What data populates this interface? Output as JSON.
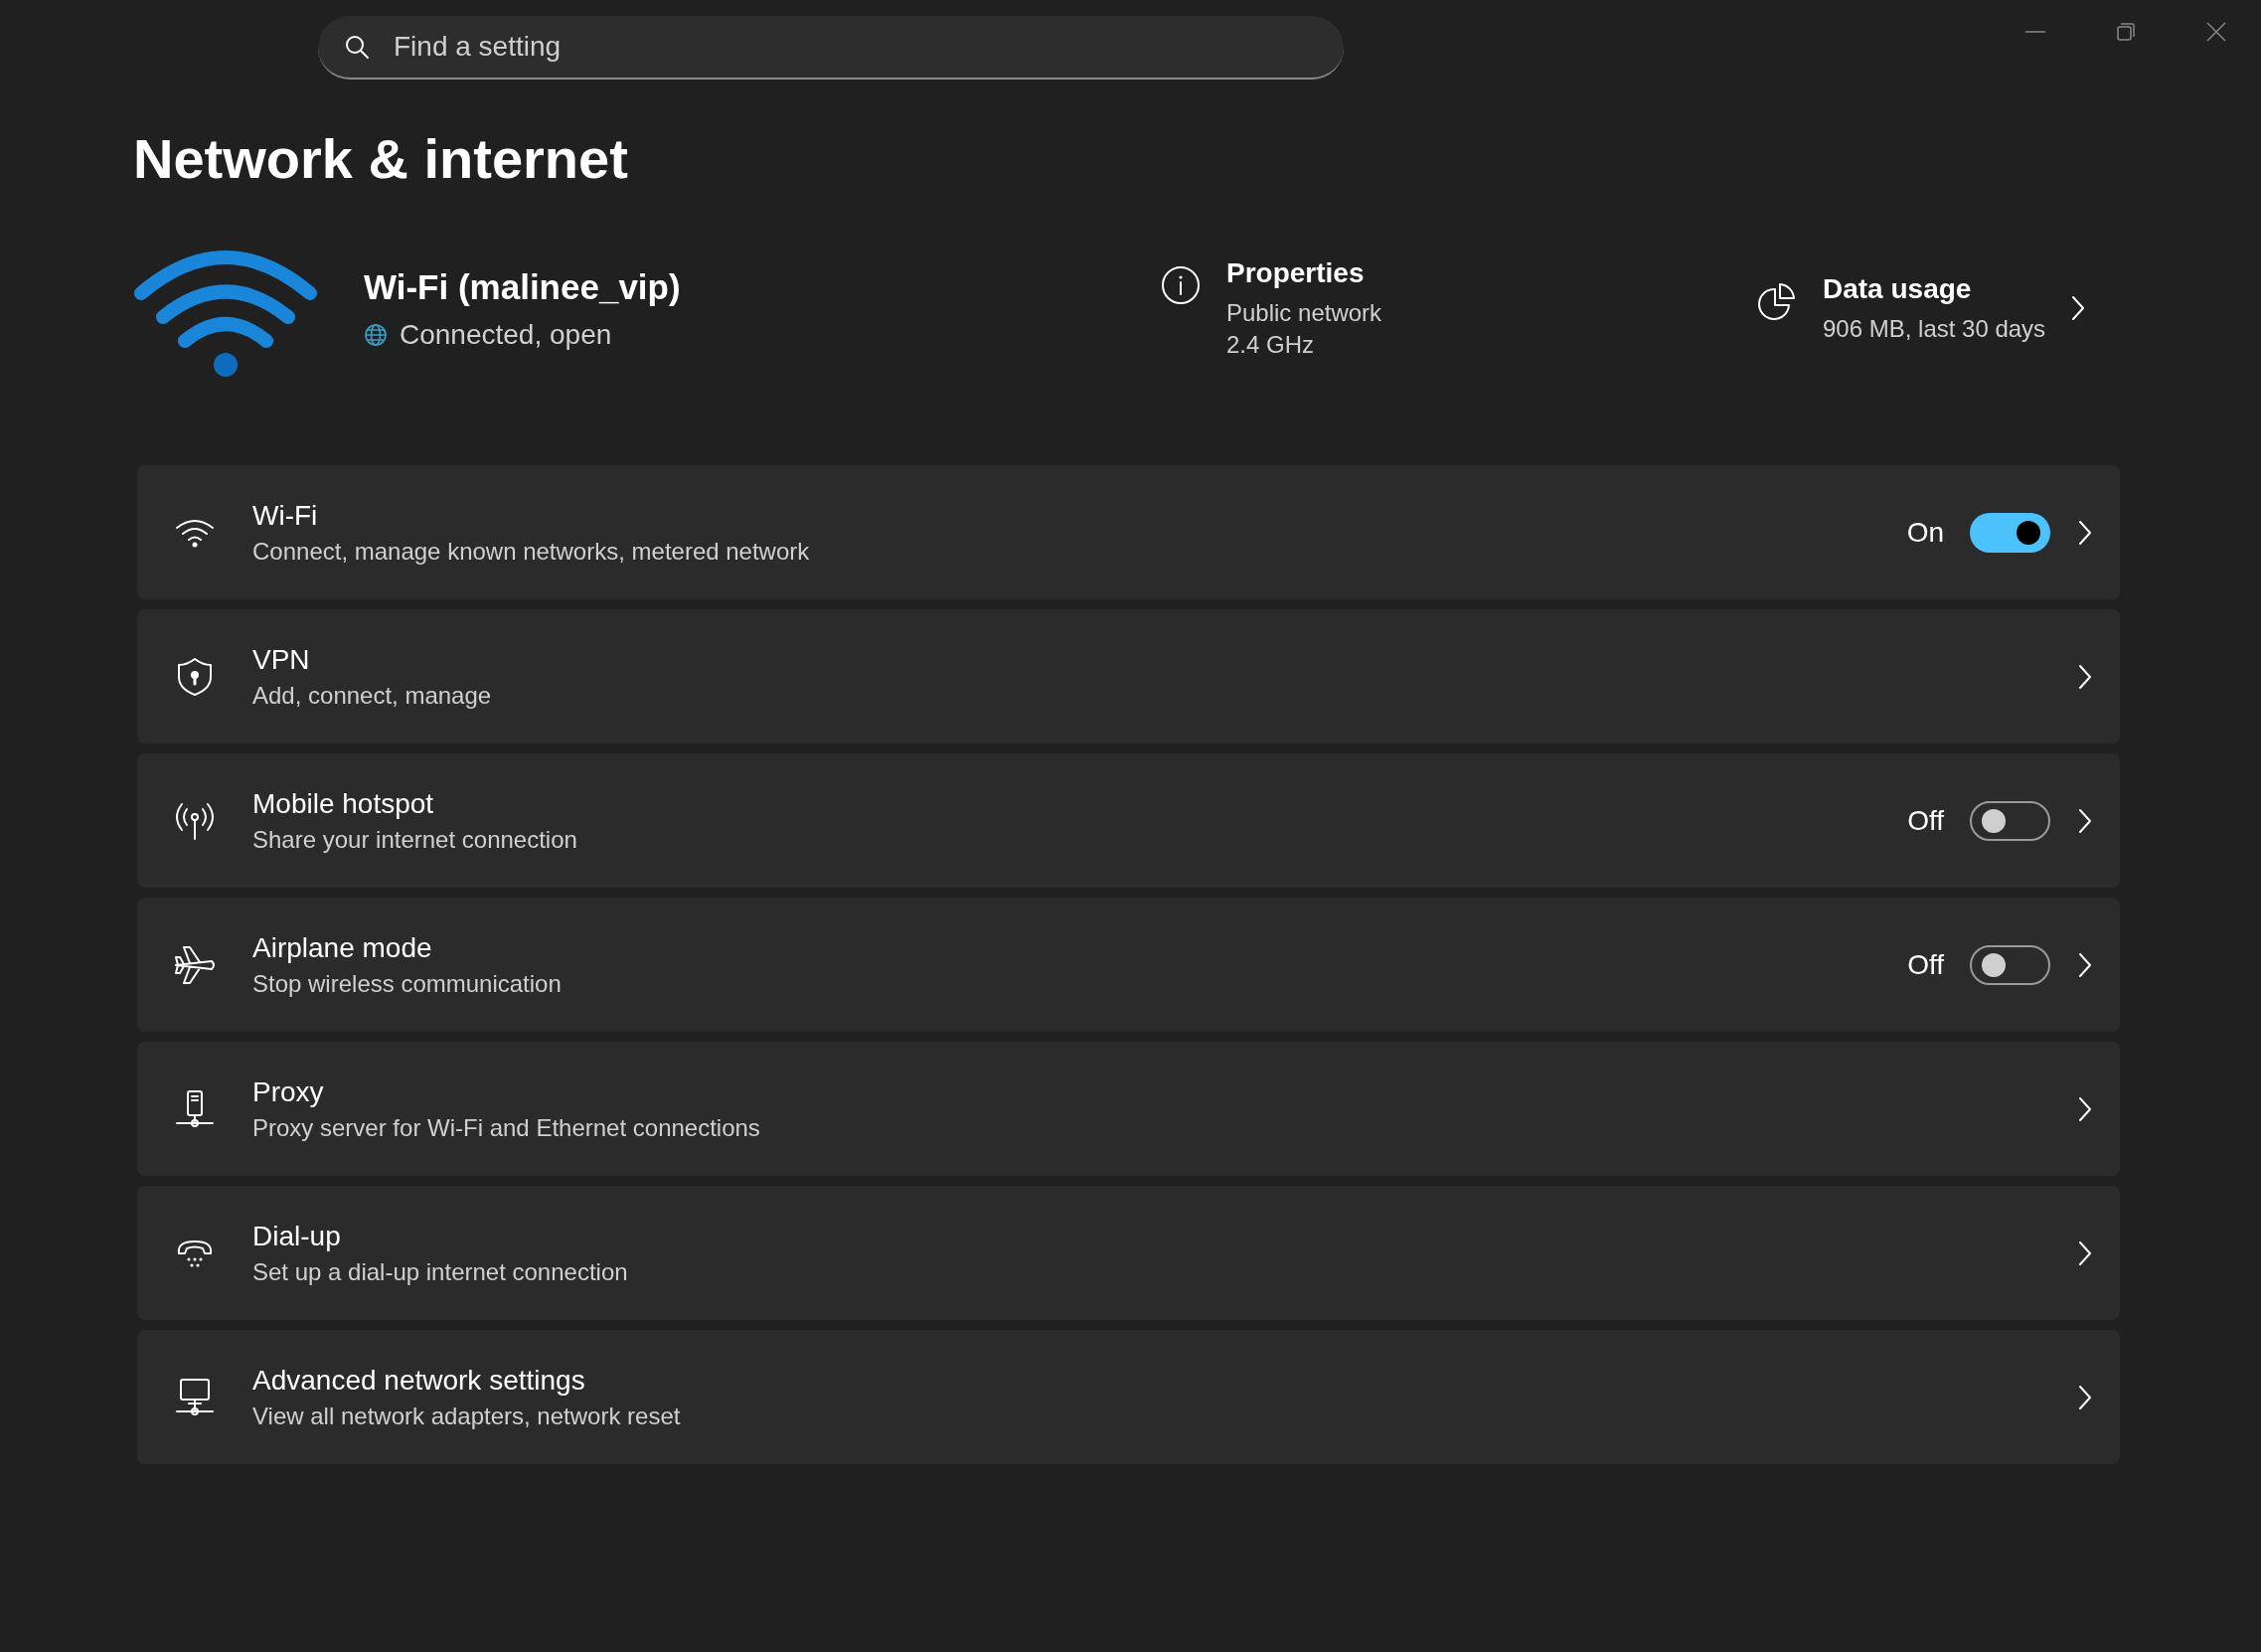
{
  "search": {
    "placeholder": "Find a setting"
  },
  "title": "Network & internet",
  "connection": {
    "name": "Wi-Fi (malinee_vip)",
    "status": "Connected, open"
  },
  "properties": {
    "title": "Properties",
    "lines": [
      "Public network",
      "2.4 GHz"
    ]
  },
  "data_usage": {
    "title": "Data usage",
    "detail": "906 MB, last 30 days"
  },
  "items": [
    {
      "kind": "toggle",
      "title": "Wi-Fi",
      "subtitle": "Connect, manage known networks, metered network",
      "state_label": "On",
      "on": true
    },
    {
      "kind": "link",
      "title": "VPN",
      "subtitle": "Add, connect, manage"
    },
    {
      "kind": "toggle",
      "title": "Mobile hotspot",
      "subtitle": "Share your internet connection",
      "state_label": "Off",
      "on": false
    },
    {
      "kind": "toggle",
      "title": "Airplane mode",
      "subtitle": "Stop wireless communication",
      "state_label": "Off",
      "on": false
    },
    {
      "kind": "link",
      "title": "Proxy",
      "subtitle": "Proxy server for Wi-Fi and Ethernet connections"
    },
    {
      "kind": "link",
      "title": "Dial-up",
      "subtitle": "Set up a dial-up internet connection"
    },
    {
      "kind": "link",
      "title": "Advanced network settings",
      "subtitle": "View all network adapters, network reset"
    }
  ]
}
